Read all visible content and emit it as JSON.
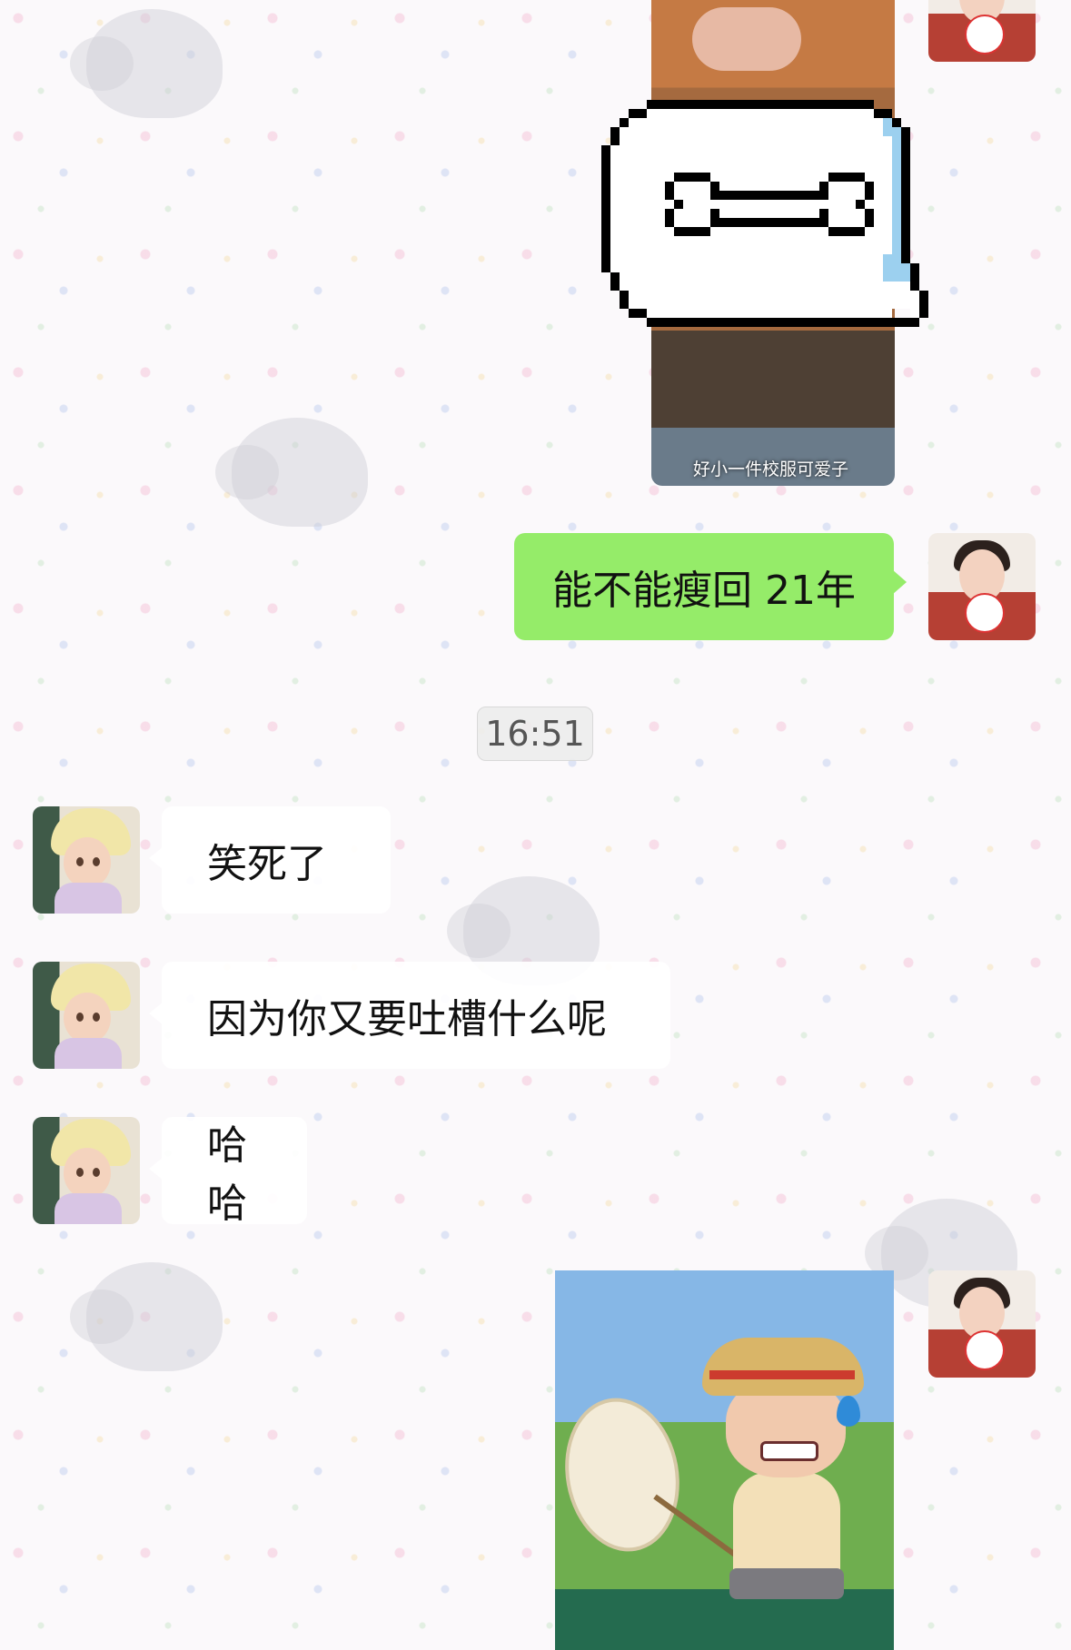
{
  "conversation": {
    "messages": [
      {
        "sender": "me",
        "type": "image",
        "caption": "好小一件校服可爱子"
      },
      {
        "sender": "me",
        "type": "sticker",
        "icon": "pixel-bone-speech-bubble"
      },
      {
        "sender": "me",
        "type": "text",
        "text": "能不能瘦回 21年"
      },
      {
        "type": "timestamp",
        "text": "16:51"
      },
      {
        "sender": "friend",
        "type": "text",
        "text": "笑死了"
      },
      {
        "sender": "friend",
        "type": "text",
        "text": "因为你又要吐槽什么呢"
      },
      {
        "sender": "friend",
        "type": "text",
        "text": "哈哈"
      },
      {
        "sender": "me",
        "type": "sticker",
        "icon": "straw-hat-boy-with-net-sticker"
      }
    ]
  },
  "colors": {
    "my_bubble": "#95ec69",
    "friend_bubble": "#ffffff",
    "timestamp_bg": "#ececec"
  }
}
